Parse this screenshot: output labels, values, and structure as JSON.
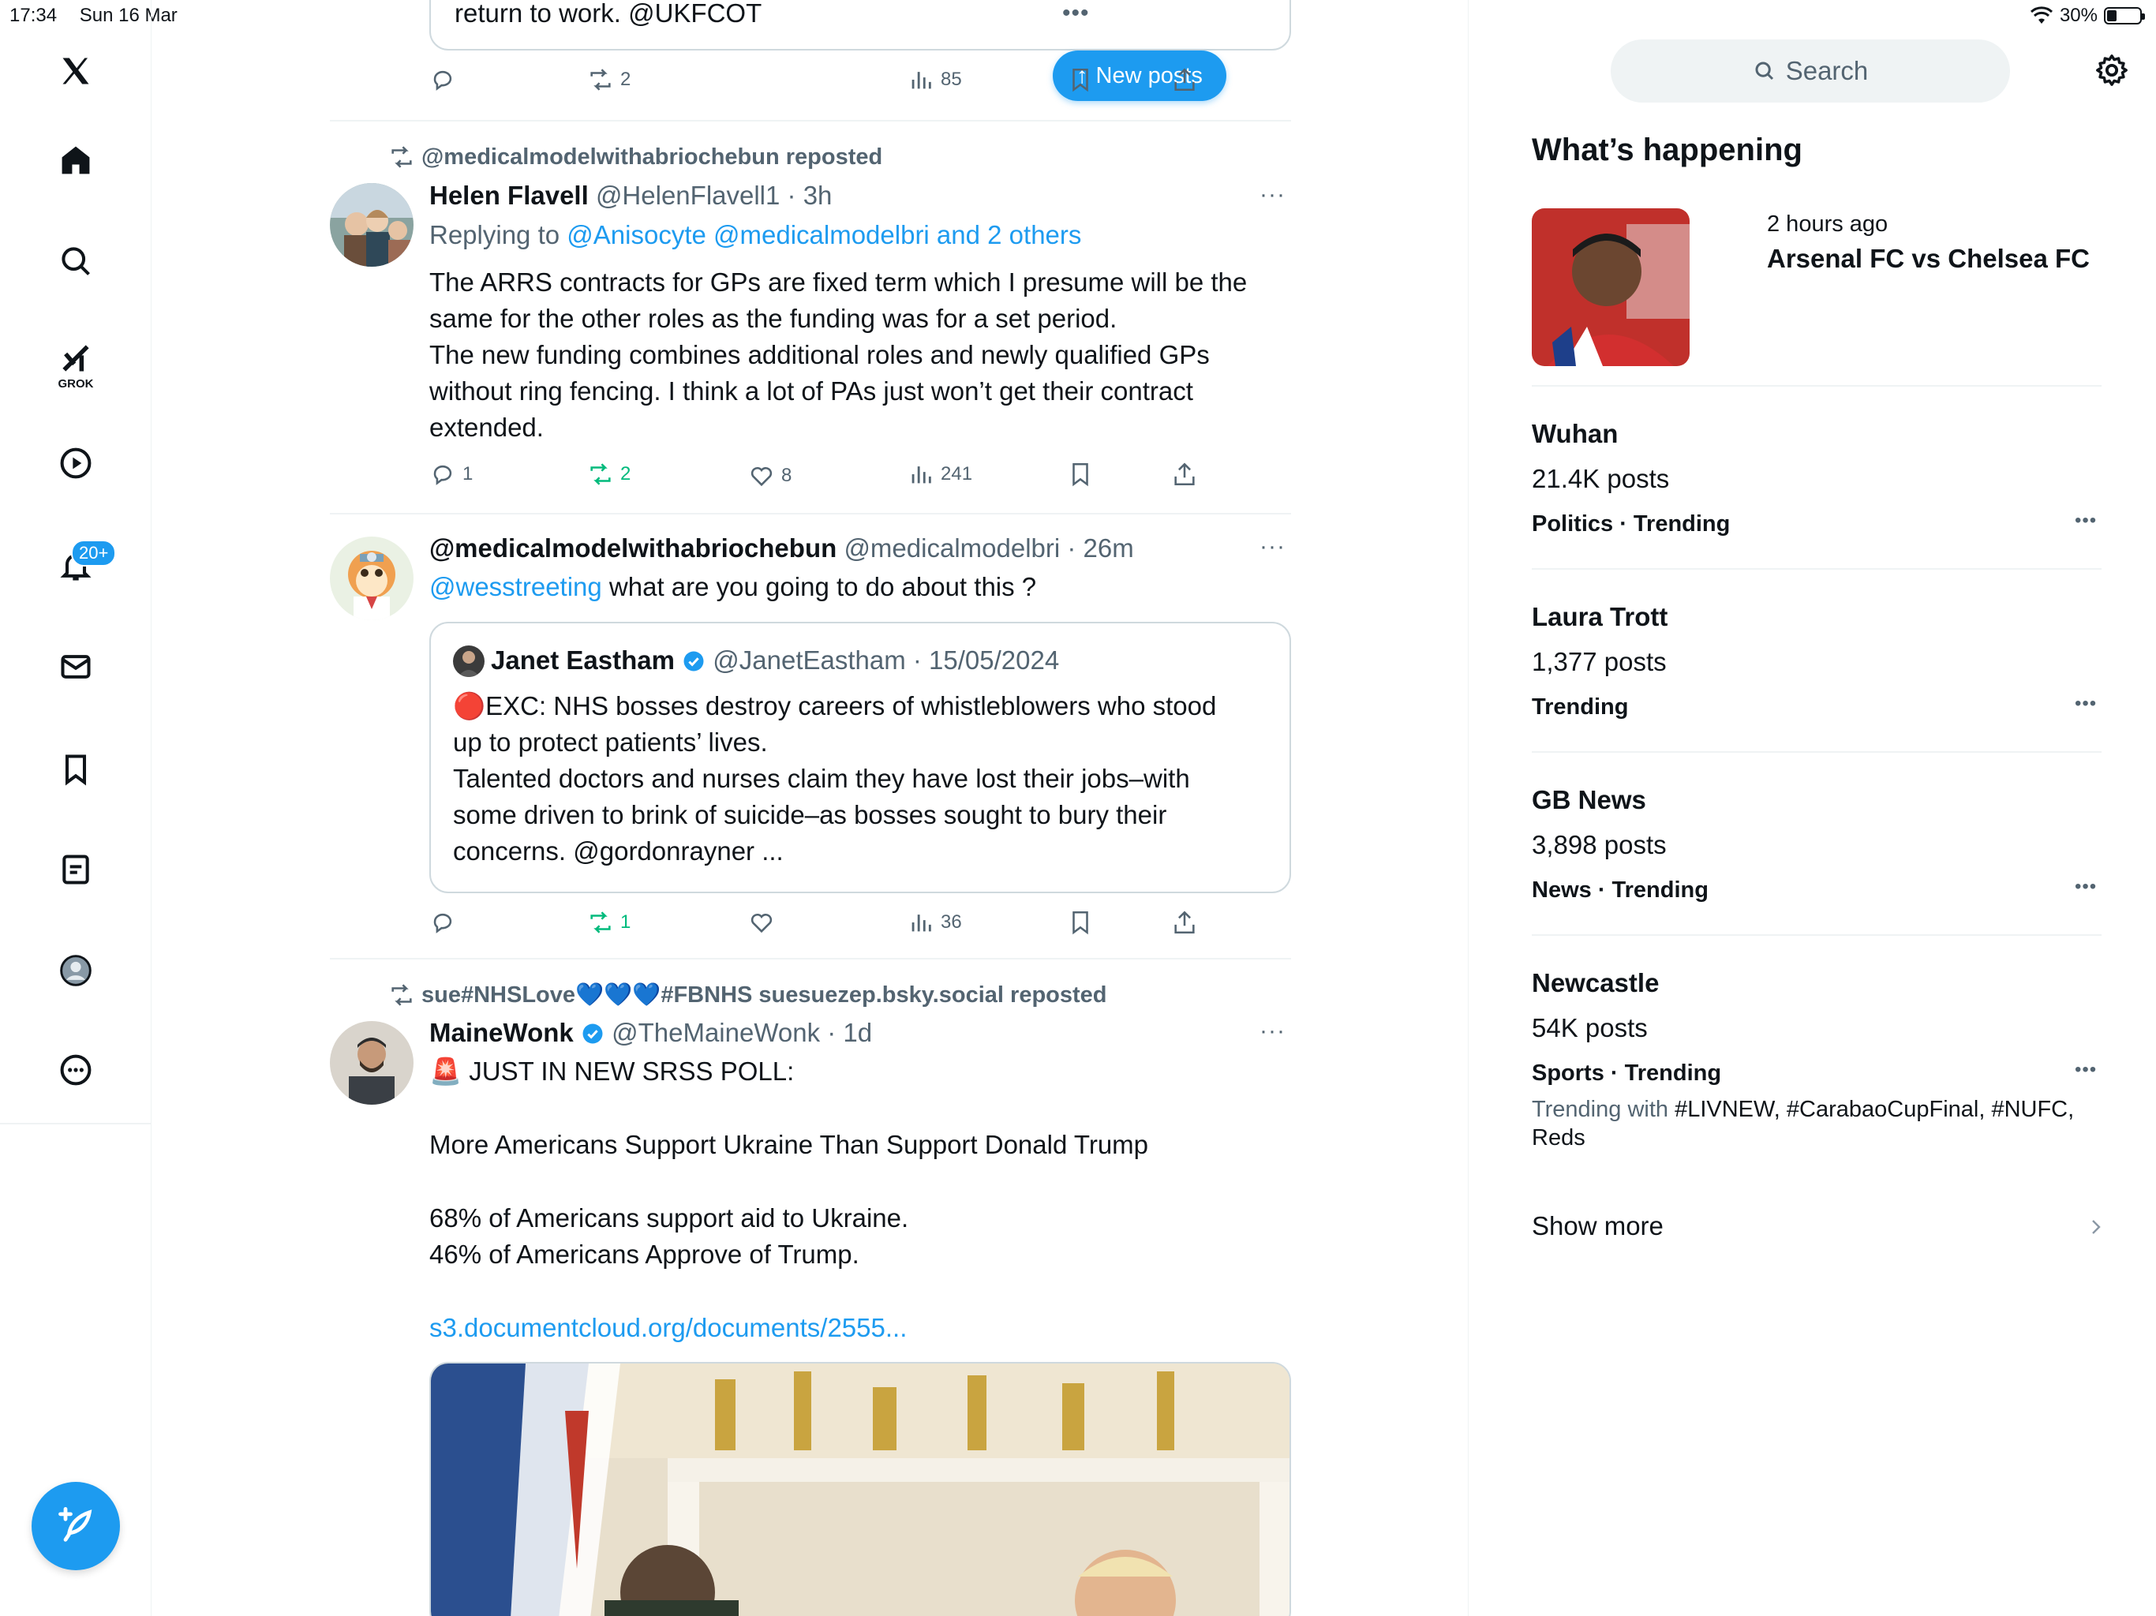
{
  "status_bar": {
    "time": "17:34",
    "date": "Sun 16 Mar",
    "battery": "30%",
    "battery_level": 0.3
  },
  "nav": {
    "grok_label": "GROK",
    "notifications_badge": "20+"
  },
  "new_posts_label": "New posts",
  "top_post": {
    "text": "return to work. @UKFCOT",
    "retweets": "2",
    "views": "85"
  },
  "post1": {
    "reposted_by": "@medicalmodelwithabriochebun reposted",
    "name": "Helen Flavell",
    "handle_time": "@HelenFlavell1 · 3h",
    "replying_prefix": "Replying to ",
    "replying_to": "@Anisocyte @medicalmodelbri and 2 others",
    "lines": [
      "The ARRS contracts for GPs are fixed term which I presume will be the",
      "same for the other roles as the funding was for a set period.",
      "The new funding combines additional roles and newly qualified GPs",
      "without ring fencing. I think a lot of PAs just won’t get their contract",
      "extended."
    ],
    "replies": "1",
    "retweets": "2",
    "likes": "8",
    "views": "241"
  },
  "post2": {
    "name": "@medicalmodelwithabriochebun",
    "handle_time": "@medicalmodelbri · 26m",
    "mention": "@wesstreeting",
    "text": " what are you going to do about this ?",
    "quote": {
      "name": "Janet Eastham",
      "handle_time": "@JanetEastham · 15/05/2024",
      "lines": [
        "🔴EXC: NHS bosses destroy careers of whistleblowers who stood",
        "up to protect patients’ lives.",
        "Talented doctors and nurses claim they have lost their jobs–with",
        "some driven to brink of suicide–as bosses sought to bury their",
        "concerns. @gordonrayner ..."
      ]
    },
    "retweets": "1",
    "views": "36"
  },
  "post3": {
    "reposted_by": "sue#NHSLove💙💙💙#FBNHS suesuezep.bsky.social reposted",
    "name": "MaineWonk",
    "handle_time": "@TheMaineWonk · 1d",
    "line1": "🚨 JUST IN NEW SRSS POLL:",
    "line2": "More Americans Support Ukraine Than Support Donald Trump",
    "line3": "68% of Americans support aid to Ukraine.",
    "line4": "46% of Americans Approve of Trump.",
    "link": "s3.documentcloud.org/documents/2555..."
  },
  "sidebar": {
    "search_placeholder": "Search",
    "heading": "What’s happening",
    "featured": {
      "time": "2 hours ago",
      "title": "Arsenal FC vs Chelsea FC"
    },
    "trends": [
      {
        "title": "Wuhan",
        "posts": "21.4K posts",
        "category": "Politics · Trending"
      },
      {
        "title": "Laura Trott",
        "posts": "1,377 posts",
        "category": "Trending"
      },
      {
        "title": "GB News",
        "posts": "3,898 posts",
        "category": "News · Trending"
      },
      {
        "title": "Newcastle",
        "posts": "54K posts",
        "category": "Sports · Trending",
        "trending_with_prefix": "Trending with ",
        "trending_with": "#LIVNEW, #CarabaoCupFinal, #NUFC,",
        "trending_with_2": "Reds"
      }
    ],
    "show_more": "Show more"
  },
  "colors": {
    "accent": "#1d9bf0",
    "retweet_green": "#00ba7c",
    "muted": "#536471"
  }
}
